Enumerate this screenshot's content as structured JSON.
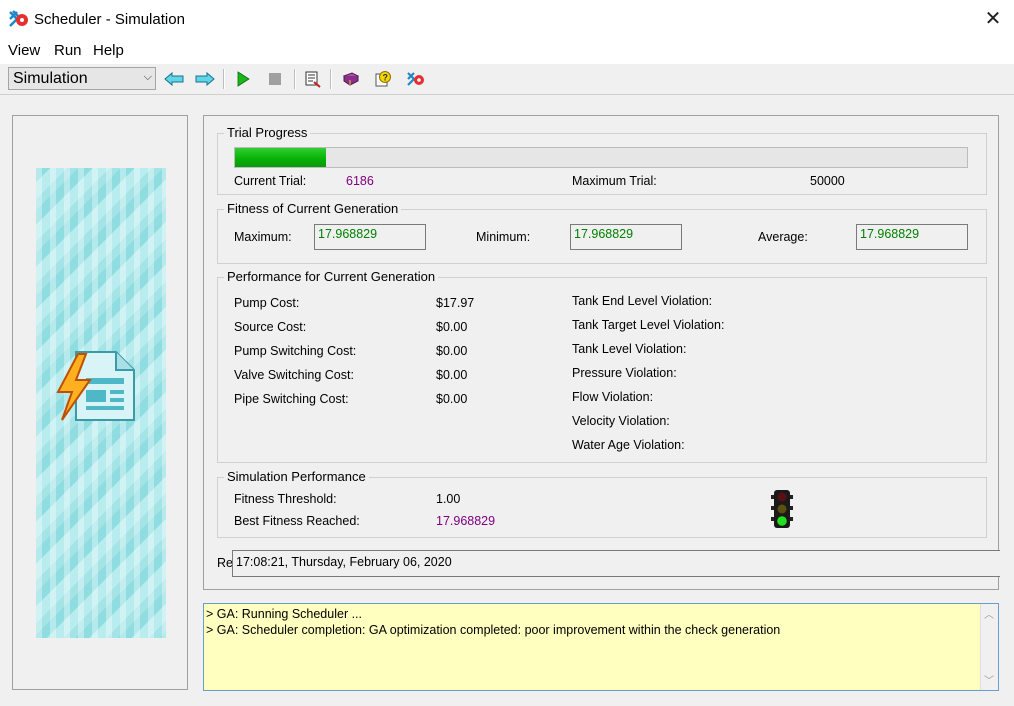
{
  "window": {
    "title": "Scheduler - Simulation",
    "close_glyph": "✕"
  },
  "menu": [
    "View",
    "Run",
    "Help"
  ],
  "toolbar": {
    "mode_value": "Simulation",
    "icons": [
      "back-arrow-icon",
      "forward-arrow-icon",
      "play-icon",
      "stop-icon",
      "scheduler-tool-icon",
      "book-icon",
      "help-icon",
      "about-icon"
    ]
  },
  "trial_progress": {
    "title": "Trial Progress",
    "current_label": "Current Trial:",
    "current_value": "6186",
    "max_label": "Maximum Trial:",
    "max_value": "50000",
    "progress_fraction": 0.1237
  },
  "fitness": {
    "title": "Fitness of Current Generation",
    "max_label": "Maximum:",
    "max_value": "17.968829",
    "min_label": "Minimum:",
    "min_value": "17.968829",
    "avg_label": "Average:",
    "avg_value": "17.968829"
  },
  "performance": {
    "title": "Performance for Current Generation",
    "costs": [
      {
        "label": "Pump Cost:",
        "value": "$17.97"
      },
      {
        "label": "Source Cost:",
        "value": "$0.00"
      },
      {
        "label": "Pump Switching Cost:",
        "value": "$0.00"
      },
      {
        "label": "Valve Switching Cost:",
        "value": "$0.00"
      },
      {
        "label": "Pipe Switching Cost:",
        "value": "$0.00"
      }
    ],
    "violations": [
      "Tank End Level Violation:",
      "Tank Target Level Violation:",
      "Tank Level Violation:",
      "Pressure Violation:",
      "Flow Violation:",
      "Velocity Violation:",
      "Water Age Violation:"
    ]
  },
  "simulation_performance": {
    "title": "Simulation Performance",
    "threshold_label": "Fitness Threshold:",
    "threshold_value": "1.00",
    "best_label": "Best Fitness Reached:",
    "best_value": "17.968829"
  },
  "status": {
    "prefix": "Re",
    "timestamp": "17:08:21, Thursday, February 06, 2020"
  },
  "log": [
    "> GA: Running Scheduler ...",
    "> GA: Scheduler completion: GA optimization completed: poor improvement within the check generation"
  ],
  "colors": {
    "progress": "#06b006",
    "value_purple": "#800080",
    "value_green": "#008000",
    "log_bg": "#ffffc0"
  }
}
